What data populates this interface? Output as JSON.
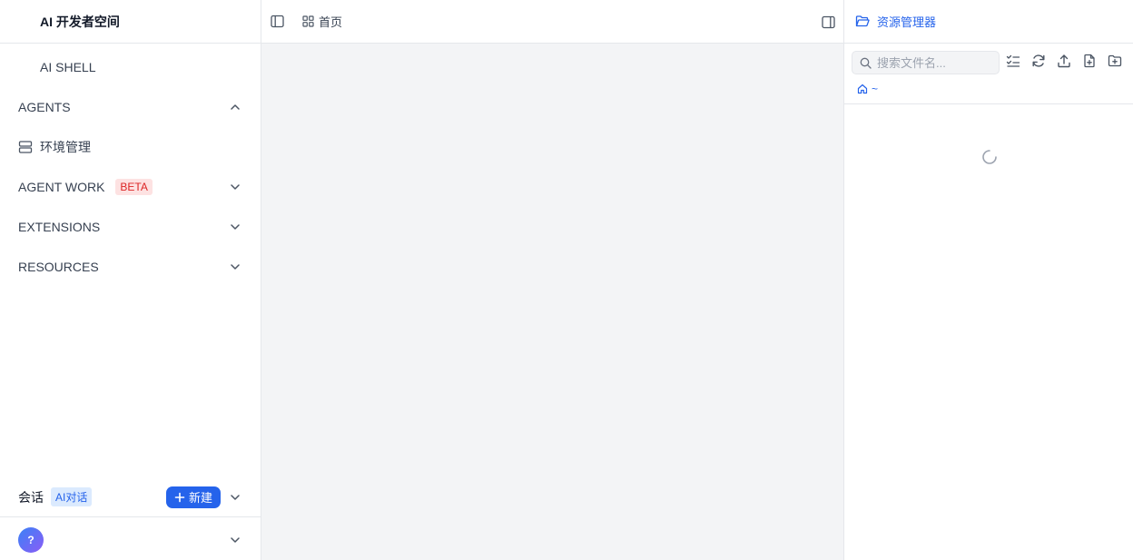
{
  "sidebar": {
    "brand": "AI 开发者空间",
    "items": [
      {
        "label": "AI SHELL"
      },
      {
        "label": "AGENTS"
      },
      {
        "label": "环境管理"
      },
      {
        "label": "AGENT WORK",
        "badge": "BETA"
      },
      {
        "label": "EXTENSIONS"
      },
      {
        "label": "RESOURCES"
      }
    ],
    "session": {
      "label": "会话",
      "badge": "AI对话",
      "new_button": "新建"
    },
    "user": {
      "avatar_text": "?"
    }
  },
  "main": {
    "home_tab": "首页"
  },
  "explorer": {
    "title": "资源管理器",
    "search_placeholder": "搜索文件名...",
    "path": "~"
  },
  "colors": {
    "accent": "#2563eb",
    "beta_bg": "#fde2e2",
    "beta_text": "#dc2626",
    "ai_badge_bg": "#dbeafe",
    "main_bg": "#f3f4f6"
  }
}
